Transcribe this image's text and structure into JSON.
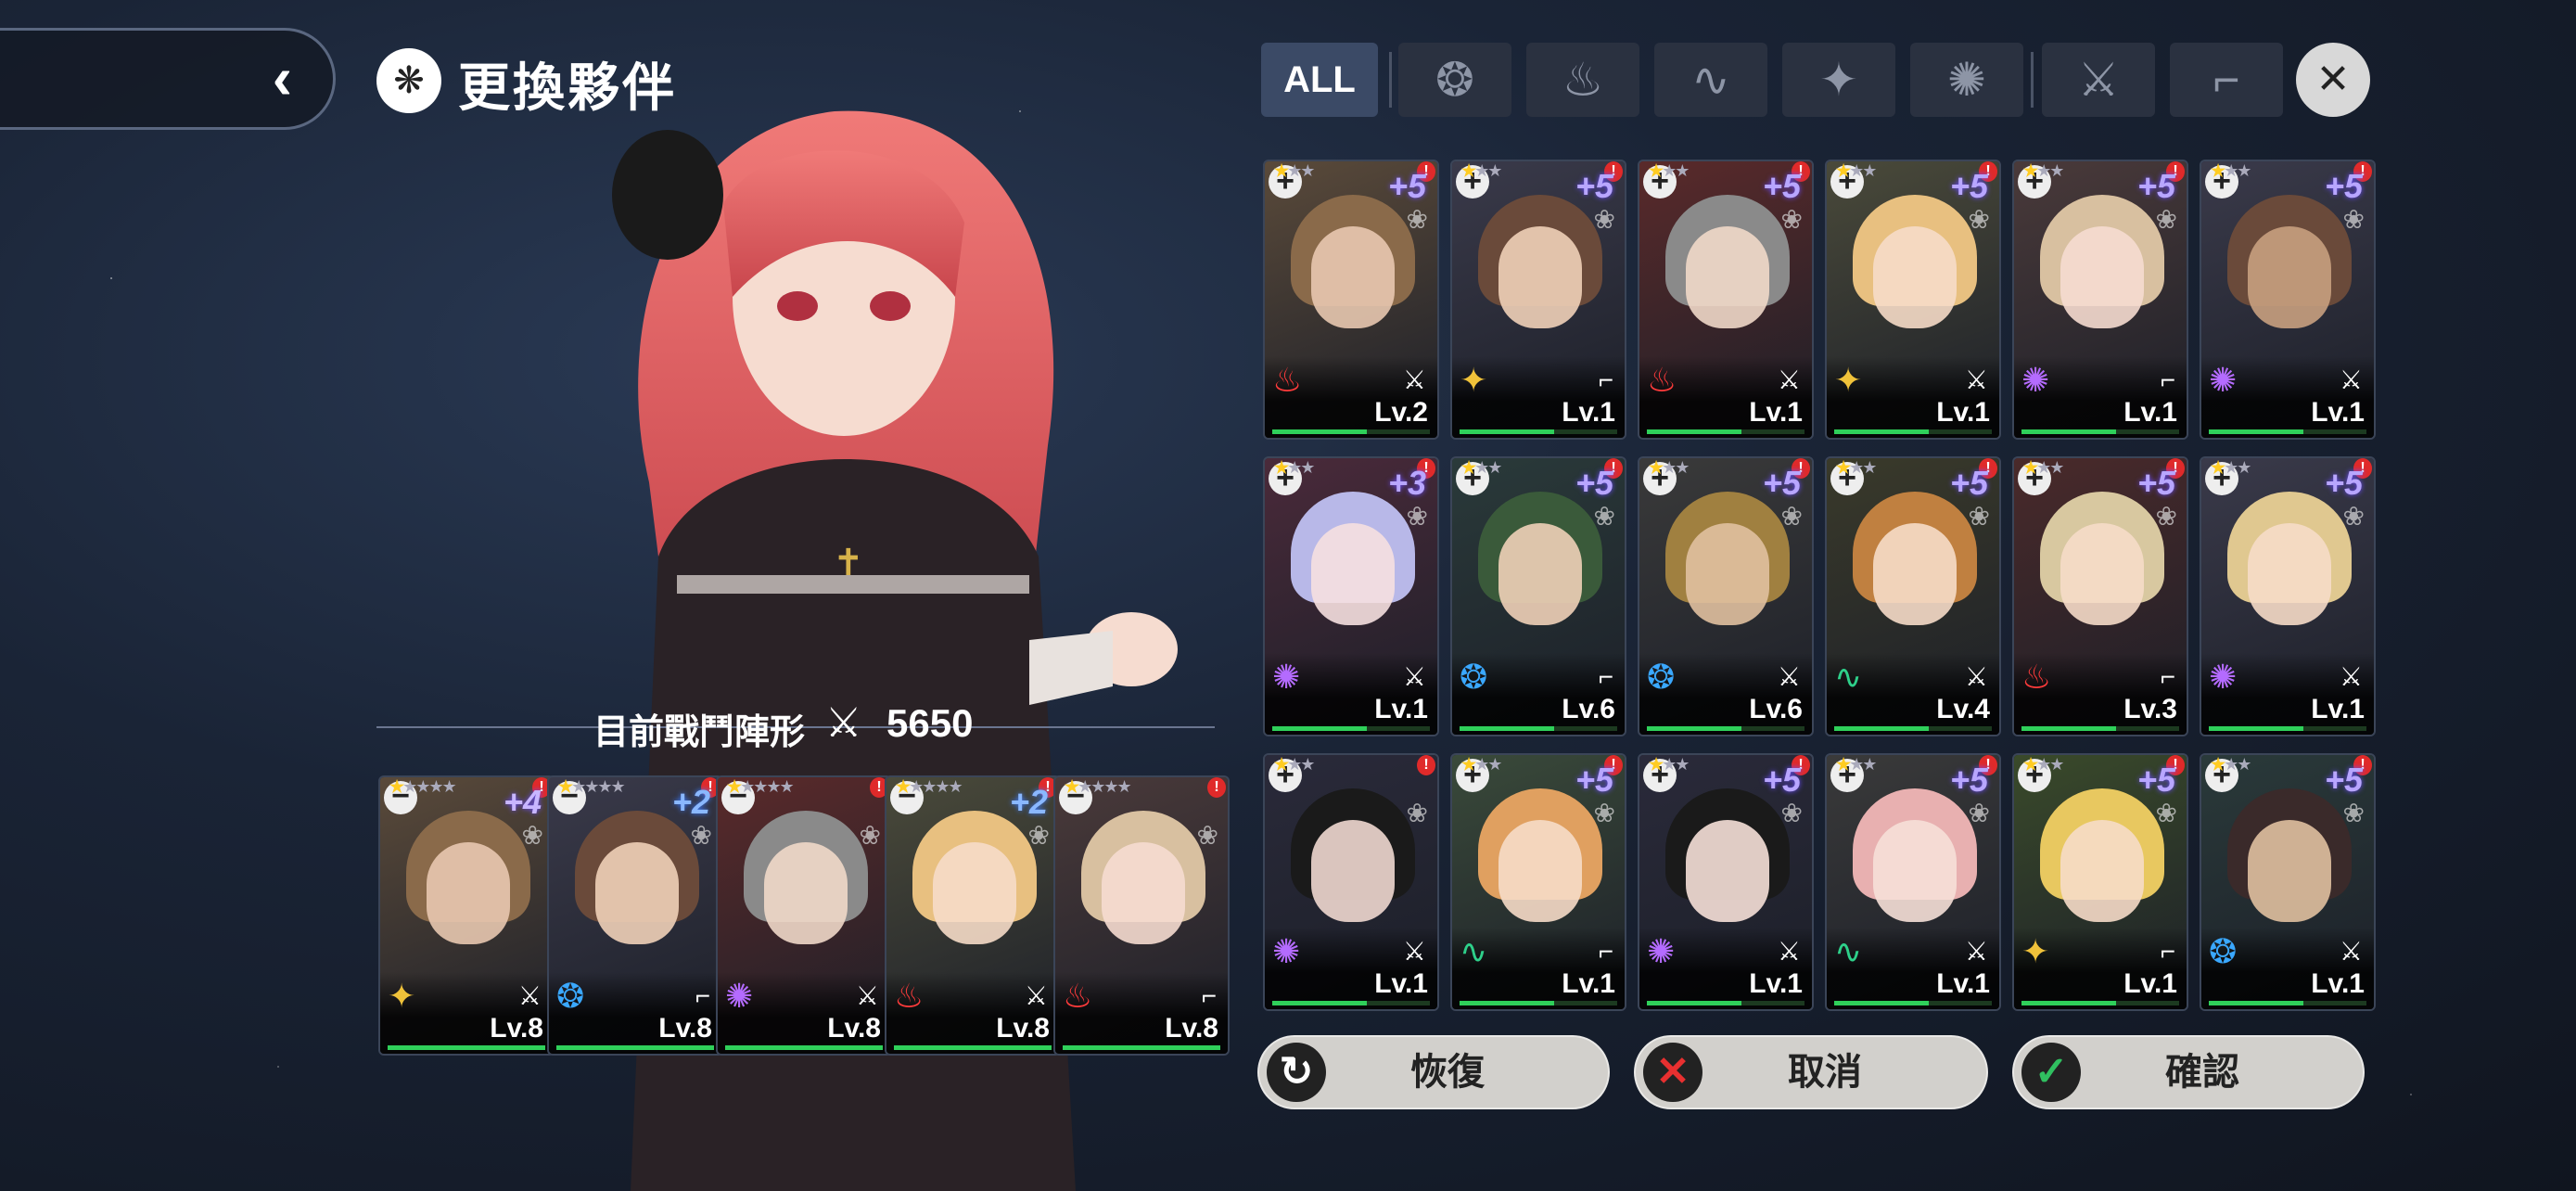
{
  "header": {
    "title": "更換夥伴",
    "back_icon": "chevron-left-icon"
  },
  "formation": {
    "label": "目前戰鬥陣形",
    "power": "5650"
  },
  "filters": {
    "all_label": "ALL",
    "tabs": [
      {
        "name": "water-element-icon",
        "glyph": "❂"
      },
      {
        "name": "fire-element-icon",
        "glyph": "♨"
      },
      {
        "name": "wind-element-icon",
        "glyph": "∿"
      },
      {
        "name": "light-element-icon",
        "glyph": "✦"
      },
      {
        "name": "dark-element-icon",
        "glyph": "✺"
      },
      {
        "name": "sword-weapon-icon",
        "glyph": "⚔"
      },
      {
        "name": "gun-weapon-icon",
        "glyph": "⌐"
      }
    ]
  },
  "team": [
    {
      "bonus": "+4",
      "level": "Lv.8",
      "element": "light",
      "stars": 1
    },
    {
      "bonus": "+2",
      "level": "Lv.8",
      "element": "water",
      "stars": 1
    },
    {
      "bonus": "",
      "level": "Lv.8",
      "element": "dark",
      "stars": 1
    },
    {
      "bonus": "+2",
      "level": "Lv.8",
      "element": "fire",
      "stars": 1
    },
    {
      "bonus": "",
      "level": "Lv.8",
      "element": "fire",
      "stars": 1
    }
  ],
  "roster": [
    {
      "bonus": "+5",
      "level": "Lv.2",
      "element": "fire",
      "stars": 1
    },
    {
      "bonus": "+5",
      "level": "Lv.1",
      "element": "light",
      "stars": 1
    },
    {
      "bonus": "+5",
      "level": "Lv.1",
      "element": "fire",
      "stars": 1
    },
    {
      "bonus": "+5",
      "level": "Lv.1",
      "element": "light",
      "stars": 1
    },
    {
      "bonus": "+5",
      "level": "Lv.1",
      "element": "dark",
      "stars": 1
    },
    {
      "bonus": "+5",
      "level": "Lv.1",
      "element": "dark",
      "stars": 1
    },
    {
      "bonus": "+3",
      "level": "Lv.1",
      "element": "dark",
      "stars": 1
    },
    {
      "bonus": "+5",
      "level": "Lv.6",
      "element": "water",
      "stars": 1
    },
    {
      "bonus": "+5",
      "level": "Lv.6",
      "element": "water",
      "stars": 1
    },
    {
      "bonus": "+5",
      "level": "Lv.4",
      "element": "wind",
      "stars": 1
    },
    {
      "bonus": "+5",
      "level": "Lv.3",
      "element": "fire",
      "stars": 1
    },
    {
      "bonus": "+5",
      "level": "Lv.1",
      "element": "dark",
      "stars": 1
    },
    {
      "bonus": "",
      "level": "Lv.1",
      "element": "dark",
      "stars": 1
    },
    {
      "bonus": "+5",
      "level": "Lv.1",
      "element": "wind",
      "stars": 1
    },
    {
      "bonus": "+5",
      "level": "Lv.1",
      "element": "dark",
      "stars": 1
    },
    {
      "bonus": "+5",
      "level": "Lv.1",
      "element": "wind",
      "stars": 1
    },
    {
      "bonus": "+5",
      "level": "Lv.1",
      "element": "light",
      "stars": 1
    },
    {
      "bonus": "+5",
      "level": "Lv.1",
      "element": "water",
      "stars": 1
    }
  ],
  "buttons": {
    "reset": "恢復",
    "cancel": "取消",
    "confirm": "確認"
  },
  "colors": {
    "fire": "#ff3b3b",
    "water": "#3aa8ff",
    "wind": "#2ed08a",
    "light": "#f0c23a",
    "dark": "#b46bff"
  }
}
